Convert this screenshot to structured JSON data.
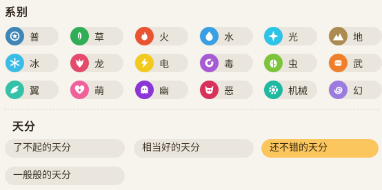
{
  "types_title": "系别",
  "talent_title": "天分",
  "types": [
    {
      "label": "普",
      "color": "#3f86b8",
      "icon": "star-icon"
    },
    {
      "label": "草",
      "color": "#2fae55",
      "icon": "leaf-icon"
    },
    {
      "label": "火",
      "color": "#ea5432",
      "icon": "flame-icon"
    },
    {
      "label": "水",
      "color": "#3a9fe3",
      "icon": "water-drop-icon"
    },
    {
      "label": "光",
      "color": "#2fc3e6",
      "icon": "light-star-icon"
    },
    {
      "label": "地",
      "color": "#ad8a4f",
      "icon": "mountain-icon"
    },
    {
      "label": "冰",
      "color": "#39bde7",
      "icon": "snowflake-icon"
    },
    {
      "label": "龙",
      "color": "#e34a6c",
      "icon": "dragon-icon"
    },
    {
      "label": "电",
      "color": "#f2ca1d",
      "icon": "lightning-icon"
    },
    {
      "label": "毒",
      "color": "#a65ad4",
      "icon": "poison-icon"
    },
    {
      "label": "虫",
      "color": "#7cc43a",
      "icon": "bug-icon"
    },
    {
      "label": "武",
      "color": "#ef7f2a",
      "icon": "fist-icon"
    },
    {
      "label": "翼",
      "color": "#33c2a8",
      "icon": "wing-icon"
    },
    {
      "label": "萌",
      "color": "#f0609a",
      "icon": "heart-icon"
    },
    {
      "label": "幽",
      "color": "#8a35d6",
      "icon": "ghost-icon"
    },
    {
      "label": "恶",
      "color": "#d6325a",
      "icon": "demon-icon"
    },
    {
      "label": "机械",
      "color": "#1fb8a1",
      "icon": "gear-icon"
    },
    {
      "label": "幻",
      "color": "#9b7be0",
      "icon": "spiral-icon"
    }
  ],
  "talents": [
    {
      "label": "了不起的天分",
      "selected": false
    },
    {
      "label": "相当好的天分",
      "selected": false
    },
    {
      "label": "还不错的天分",
      "selected": true
    },
    {
      "label": "一般般的天分",
      "selected": false
    }
  ]
}
